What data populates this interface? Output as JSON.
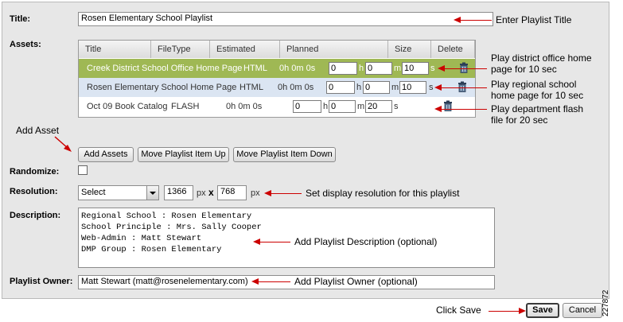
{
  "form": {
    "title_label": "Title:",
    "title_value": "Rosen Elementary School Playlist",
    "assets_label": "Assets:",
    "columns": [
      "Title",
      "FileType",
      "Estimated",
      "Planned",
      "Size",
      "Delete"
    ],
    "rows": [
      {
        "title": "Creek District School Office Home Page",
        "filetype": "HTML",
        "estimated": "0h 0m 0s",
        "h": "0",
        "m": "0",
        "s": "10"
      },
      {
        "title": "Rosen Elementary School Home Page",
        "filetype": "HTML",
        "estimated": "0h 0m 0s",
        "h": "0",
        "m": "0",
        "s": "10"
      },
      {
        "title": "Oct 09 Book Catalog",
        "filetype": "FLASH",
        "estimated": "0h 0m 0s",
        "h": "0",
        "m": "0",
        "s": "20"
      }
    ],
    "unit_h": "h",
    "unit_m": "m",
    "unit_s": "s",
    "buttons": {
      "add_assets": "Add Assets",
      "move_up": "Move Playlist Item Up",
      "move_down": "Move Playlist Item Down",
      "save": "Save",
      "cancel": "Cancel"
    },
    "randomize_label": "Randomize:",
    "resolution_label": "Resolution:",
    "resolution_select": "Select",
    "resolution_width": "1366",
    "resolution_height": "768",
    "px": "px",
    "x": "x",
    "description_label": "Description:",
    "description_lines": [
      "Regional School : Rosen Elementary",
      "School Principle : Mrs. Sally Cooper",
      "Web-Admin : Matt Stewart",
      "DMP Group : Rosen Elementary"
    ],
    "owner_label": "Playlist Owner:",
    "owner_value": "Matt Stewart (matt@rosenelementary.com)"
  },
  "annotations": {
    "enter_title": "Enter Playlist Title",
    "row1_note_1": "Play district office home",
    "row1_note_2": "page for 10 sec",
    "row2_note_1": "Play regional school",
    "row2_note_2": "home page for 10 sec",
    "row3_note_1": "Play department flash",
    "row3_note_2": "file for 20 sec",
    "add_asset": "Add Asset",
    "set_resolution": "Set display resolution for this playlist",
    "add_description": "Add Playlist Description (optional)",
    "add_owner": "Add Playlist Owner (optional)",
    "click_save": "Click Save",
    "figure_id": "227872"
  },
  "colors": {
    "selected_row": "#9fb854",
    "alt_row": "#dbe5f2",
    "arrow": "#cc0000"
  }
}
